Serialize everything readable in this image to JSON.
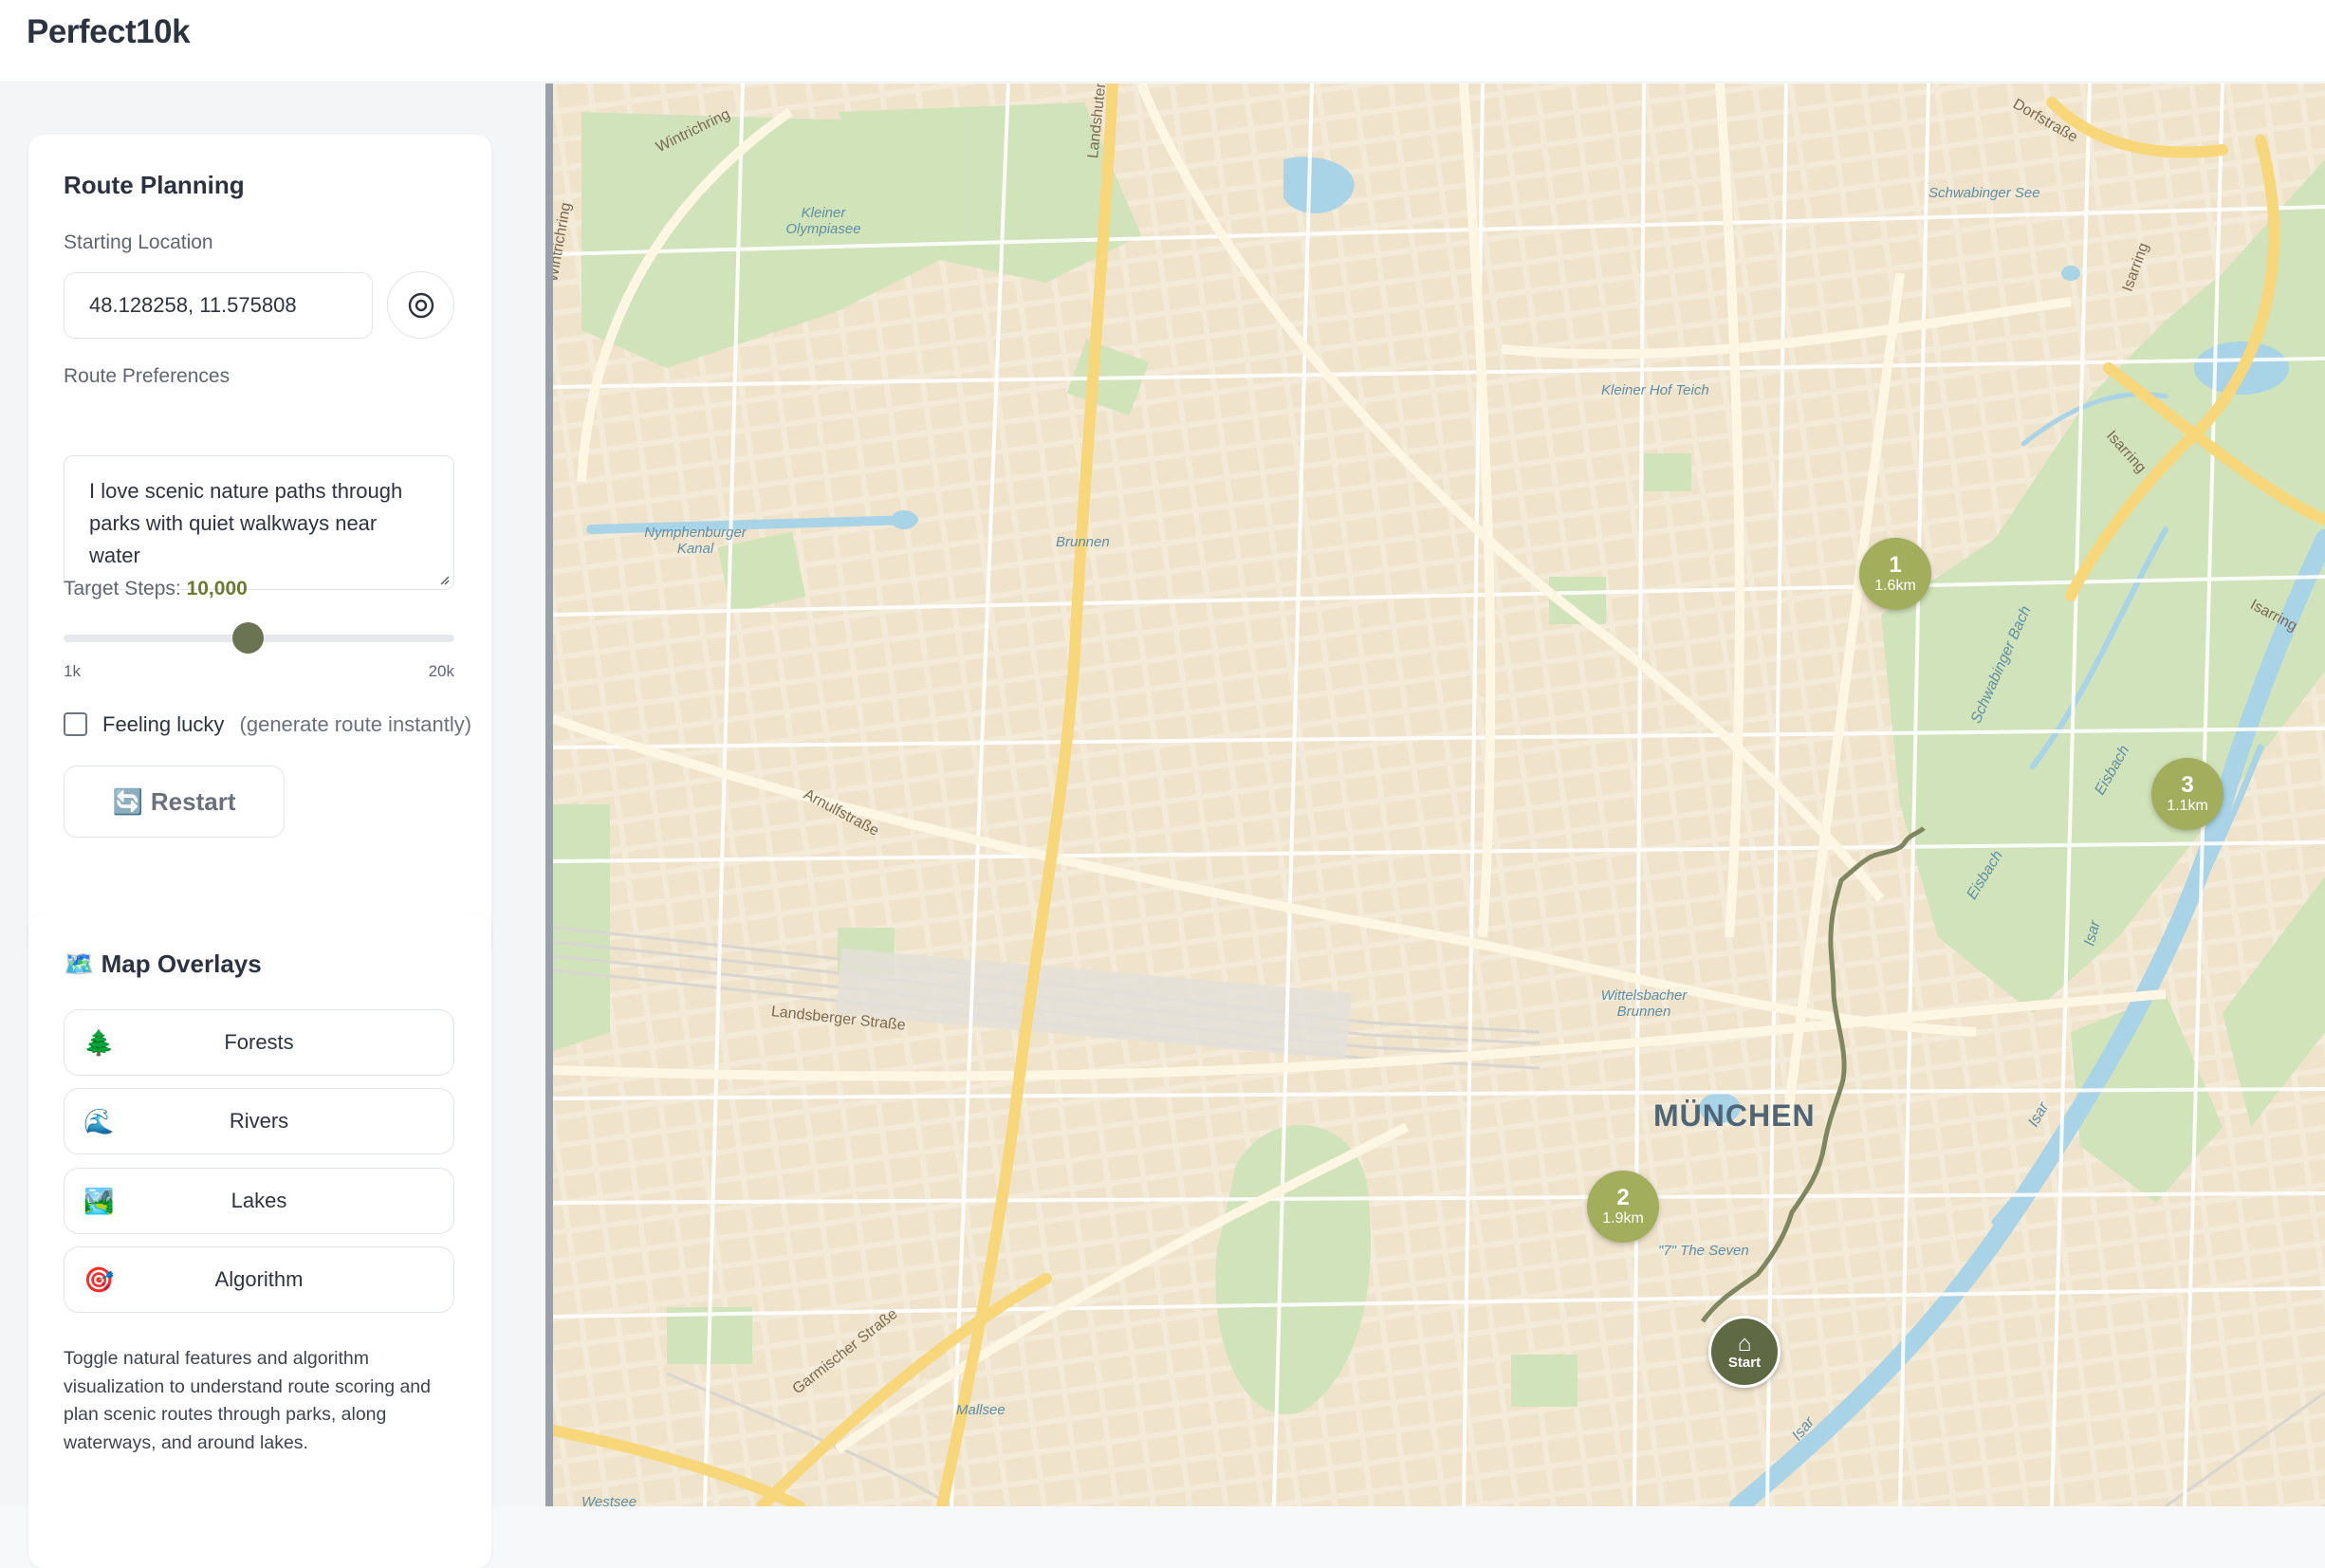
{
  "app": {
    "title": "Perfect10k"
  },
  "route_planning": {
    "title": "Route Planning",
    "starting_location_label": "Starting Location",
    "starting_location_value": "48.128258, 11.575808",
    "locate_icon": "crosshair-target-icon",
    "preferences_label": "Route Preferences",
    "preferences_value": "I love scenic nature paths through parks with quiet walkways near water",
    "target_steps_label": "Target Steps:",
    "target_steps_value": "10,000",
    "slider": {
      "min_label": "1k",
      "max_label": "20k",
      "level_fraction": 0.47
    },
    "feeling_lucky_label": "Feeling lucky",
    "feeling_lucky_hint": "(generate route instantly)",
    "feeling_lucky_checked": false,
    "restart_icon": "🔄",
    "restart_label": "Restart"
  },
  "map_overlays": {
    "title_icon": "🗺️",
    "title": "Map Overlays",
    "buttons": [
      {
        "icon": "🌲",
        "label": "Forests"
      },
      {
        "icon": "🌊",
        "label": "Rivers"
      },
      {
        "icon": "🏞️",
        "label": "Lakes"
      },
      {
        "icon": "🎯",
        "label": "Algorithm"
      }
    ],
    "description": "Toggle natural features and algorithm visualization to understand route scoring and plan scenic routes through parks, along waterways, and around lakes."
  },
  "map": {
    "city_label": "MÜNCHEN",
    "labels": {
      "kleiner_olympiasee": "Kleiner Olympiasee",
      "schwabinger_see": "Schwabinger See",
      "kleiner_hof_teich": "Kleiner Hof Teich",
      "nymphenburger_kanal": "Nymphenburger Kanal",
      "brunnen": "Brunnen",
      "wittelsbacher_brunnen": "Wittelsbacher Brunnen",
      "the_seven": "\"7\" The Seven",
      "mallsee": "Mallsee",
      "westsee": "Westsee",
      "wintrichring": "Wintrichring",
      "landshuter": "Landshuter",
      "arnulfstrasse": "Arnulfstraße",
      "landsberger_strasse": "Landsberger Straße",
      "garmischer_strasse": "Garmischer Straße",
      "isarring": "Isarring",
      "schwabinger_bach": "Schwabinger Bach",
      "eisbach": "Eisbach",
      "isar": "Isar",
      "dorfstrasse": "Dorfstraße"
    },
    "markers": [
      {
        "number": "1",
        "distance": "1.6km"
      },
      {
        "number": "2",
        "distance": "1.9km"
      },
      {
        "number": "3",
        "distance": "1.1km"
      }
    ],
    "start_marker": {
      "icon": "⌂",
      "label": "Start"
    },
    "colors": {
      "marker": "#a3ae5c",
      "start": "#5f6a45",
      "route": "#7f8760",
      "park": "#cfe3b8",
      "water": "#a9d3e6",
      "road": "#ffffff",
      "major_road": "#f7d77a"
    }
  }
}
